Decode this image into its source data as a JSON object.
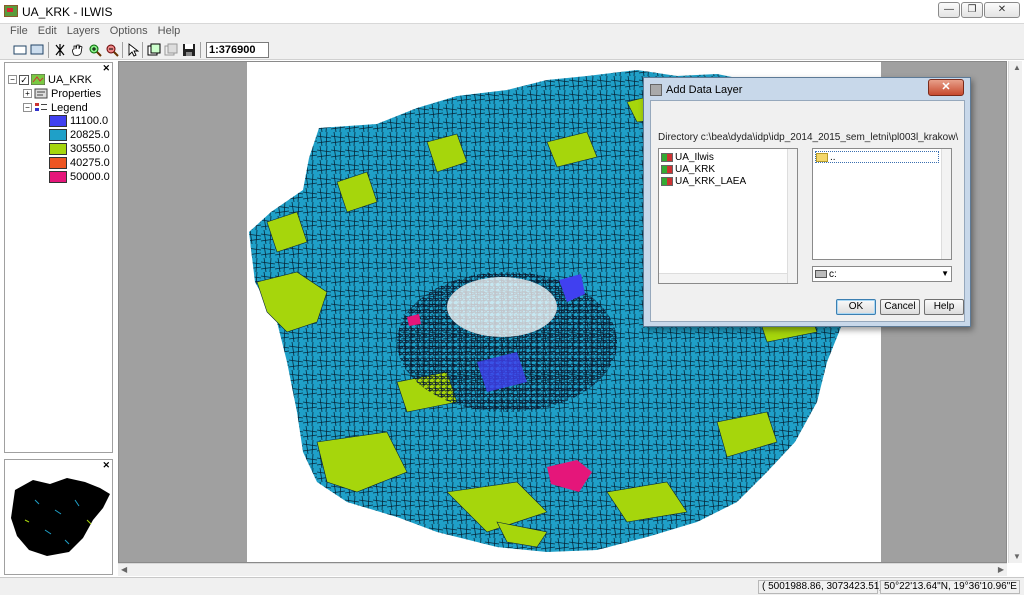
{
  "window": {
    "title": "UA_KRK - ILWIS"
  },
  "menu": [
    "File",
    "Edit",
    "Layers",
    "Options",
    "Help"
  ],
  "toolbar": {
    "scale": "1:376900"
  },
  "layer_tree": {
    "root": "UA_KRK",
    "properties": "Properties",
    "legend": "Legend",
    "legend_items": [
      {
        "value": "11100.0",
        "color": "#4040f0"
      },
      {
        "value": "20825.0",
        "color": "#1fa0c8"
      },
      {
        "value": "30550.0",
        "color": "#a6d60c"
      },
      {
        "value": "40275.0",
        "color": "#ee5522"
      },
      {
        "value": "50000.0",
        "color": "#e5167a"
      }
    ]
  },
  "statusbar": {
    "coords": "( 5001988.86,  3073423.51)",
    "latlon": "50°22'13.64\"N, 19°36'10.96\"E"
  },
  "dialog": {
    "title": "Add Data Layer",
    "directory_label": "Directory c:\\bea\\dyda\\idp\\idp_2014_2015_sem_letni\\pl003l_krakow\\",
    "files": [
      "UA_Ilwis",
      "UA_KRK",
      "UA_KRK_LAEA"
    ],
    "folders": [
      ".."
    ],
    "drive": "c:",
    "ok": "OK",
    "cancel": "Cancel",
    "help": "Help"
  },
  "colors": {
    "map_urban": "#1fa0c8",
    "map_green": "#a6d60c",
    "map_blue": "#4040f0",
    "map_pink": "#e5167a"
  }
}
